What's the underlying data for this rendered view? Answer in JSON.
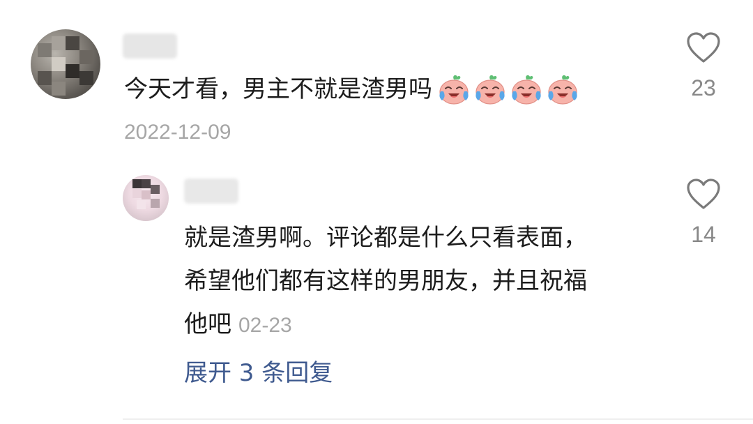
{
  "comment": {
    "text": "今天才看，男主不就是渣男吗",
    "emoji_icon": "crying-laughing-face-icon",
    "emoji_count": 4,
    "date": "2022-12-09",
    "like_count": "23",
    "like_icon": "heart-outline-icon"
  },
  "reply": {
    "lines": [
      "就是渣男啊。评论都是什么只看表面，",
      "希望他们都有这样的男朋友，并且祝福",
      "他吧"
    ],
    "date": "02-23",
    "like_count": "14",
    "like_icon": "heart-outline-icon"
  },
  "expand_replies": {
    "label": "展开 3 条回复"
  },
  "colors": {
    "text": "#1c1c1c",
    "secondary": "#a6a6a6",
    "count": "#888888",
    "link": "#3f5a8f"
  }
}
